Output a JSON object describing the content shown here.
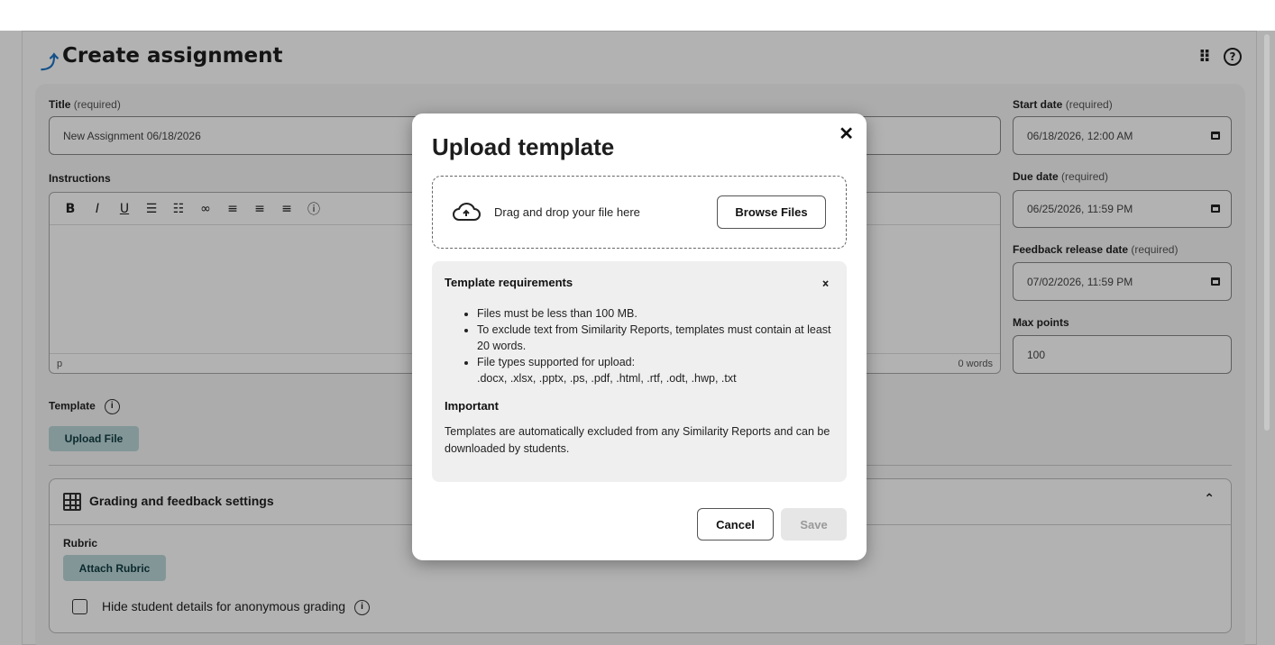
{
  "header": {
    "title": "Create assignment",
    "logo_icon": "assignment-logo-icon",
    "apps_icon": "grid-apps-icon",
    "help_icon": "help-icon"
  },
  "form": {
    "title_label": "Title",
    "title_req": "(required)",
    "title_value": "New Assignment 06/18/2026",
    "instructions_label": "Instructions",
    "editor_footer_tag": "p",
    "editor_word_count": "0 words",
    "toolbar": [
      "B",
      "I",
      "U",
      "☰",
      "☷",
      "🔗",
      "≡",
      "≡",
      "≡",
      "?"
    ],
    "start_label": "Start date",
    "start_req": "(required)",
    "start_value": "06/18/2026, 12:00 AM",
    "due_label": "Due date",
    "due_req": "(required)",
    "due_value": "06/25/2026, 11:59 PM",
    "feedback_label": "Feedback release date",
    "feedback_req": "(required)",
    "feedback_value": "07/02/2026, 11:59 PM",
    "points_label": "Max points",
    "points_value": "100",
    "template_label": "Template",
    "upload_file": "Upload File"
  },
  "grading": {
    "title": "Grading and feedback settings",
    "rubric_label": "Rubric",
    "attach_rubric": "Attach Rubric",
    "anon_label": "Hide student details for anonymous grading"
  },
  "modal": {
    "title": "Upload template",
    "drop_text": "Drag and drop your file here",
    "browse": "Browse Files",
    "req_title": "Template requirements",
    "req_items": [
      "Files must be less than 100 MB.",
      "To exclude text from Similarity Reports, templates must contain at least 20 words.",
      "File types supported for upload:",
      ".docx, .xlsx, .pptx, .ps, .pdf, .html, .rtf, .odt, .hwp, .txt"
    ],
    "important": "Important",
    "note": "Templates are automatically excluded from any Similarity Reports and can be downloaded by students.",
    "cancel": "Cancel",
    "save": "Save"
  },
  "colors": {
    "brand": "#1d74c4",
    "teal_button": "#bcd7d9",
    "overlay": "rgba(0,0,0,0.30)"
  }
}
